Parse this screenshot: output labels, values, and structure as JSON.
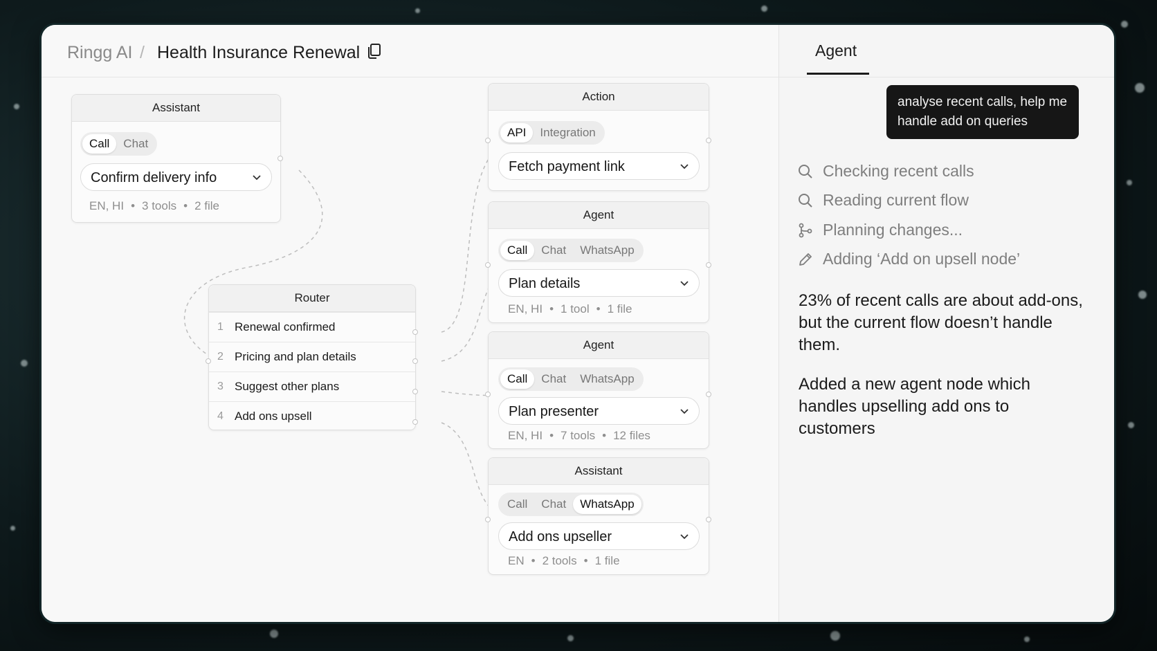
{
  "header": {
    "breadcrumb_root": "Ringg AI",
    "breadcrumb_separator": "/",
    "title": "Health Insurance Renewal",
    "copy_icon": "copy-icon"
  },
  "nodes": {
    "assistant_top": {
      "title": "Assistant",
      "channels": [
        "Call",
        "Chat"
      ],
      "active_channel": "Call",
      "selected": "Confirm delivery info",
      "meta": [
        "EN, HI",
        "3 tools",
        "2 file"
      ]
    },
    "router": {
      "title": "Router",
      "routes": [
        {
          "num": "1",
          "label": "Renewal confirmed"
        },
        {
          "num": "2",
          "label": "Pricing and plan details"
        },
        {
          "num": "3",
          "label": "Suggest other plans"
        },
        {
          "num": "4",
          "label": "Add ons upsell"
        }
      ]
    },
    "action": {
      "title": "Action",
      "channels": [
        "API",
        "Integration"
      ],
      "active_channel": "API",
      "selected": "Fetch payment link"
    },
    "agent_plan_details": {
      "title": "Agent",
      "channels": [
        "Call",
        "Chat",
        "WhatsApp"
      ],
      "active_channel": "Call",
      "selected": "Plan details",
      "meta": [
        "EN, HI",
        "1 tool",
        "1 file"
      ]
    },
    "agent_plan_presenter": {
      "title": "Agent",
      "channels": [
        "Call",
        "Chat",
        "WhatsApp"
      ],
      "active_channel": "Call",
      "selected": "Plan presenter",
      "meta": [
        "EN, HI",
        "7 tools",
        "12 files"
      ]
    },
    "assistant_upseller": {
      "title": "Assistant",
      "channels": [
        "Call",
        "Chat",
        "WhatsApp"
      ],
      "active_channel": "WhatsApp",
      "selected": "Add ons upseller",
      "meta": [
        "EN",
        "2 tools",
        "1 file"
      ]
    }
  },
  "agent_panel": {
    "tab_label": "Agent",
    "user_message": "analyse recent calls, help me handle add on queries",
    "steps": [
      {
        "icon": "search-icon",
        "label": "Checking recent calls"
      },
      {
        "icon": "search-icon",
        "label": "Reading current flow"
      },
      {
        "icon": "branch-icon",
        "label": "Planning changes..."
      },
      {
        "icon": "pencil-icon",
        "label": "Adding ‘Add on upsell node’"
      }
    ],
    "summary_1": "23% of recent calls are about add-ons, but the current flow doesn’t handle them.",
    "summary_2": "Added a new agent node which handles upselling add ons to customers"
  },
  "colors": {
    "accent_dark": "#161616",
    "muted_text": "#7e7e7e",
    "connector": "#bdbdbd"
  }
}
